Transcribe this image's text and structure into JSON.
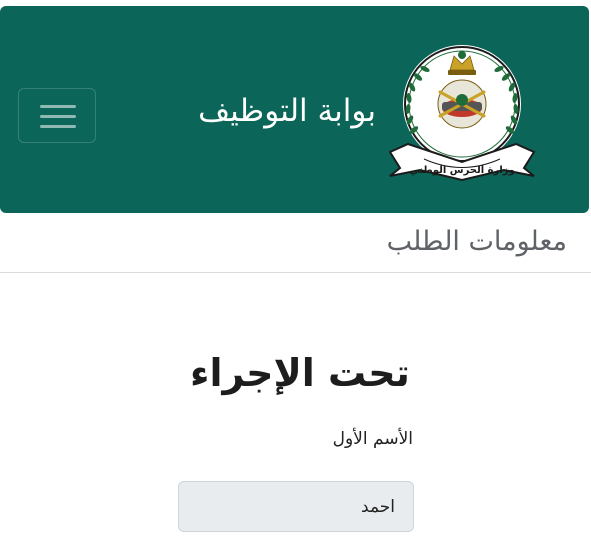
{
  "header": {
    "brand": "بوابة التوظيف",
    "logo": {
      "icon": "ministry-national-guard-emblem",
      "ribbon_text": "وزارة الحرس الوطني"
    },
    "menu_icon": "hamburger-icon"
  },
  "main": {
    "section_title": "معلومات الطلب",
    "status": "تحت الإجراء",
    "first_name": {
      "label": "الأسم الأول",
      "value": "احمد"
    }
  },
  "colors": {
    "header_bg": "#0b6559",
    "emblem_green": "#1f6b39",
    "emblem_gold": "#c9a227",
    "input_bg": "#e9ecef"
  }
}
